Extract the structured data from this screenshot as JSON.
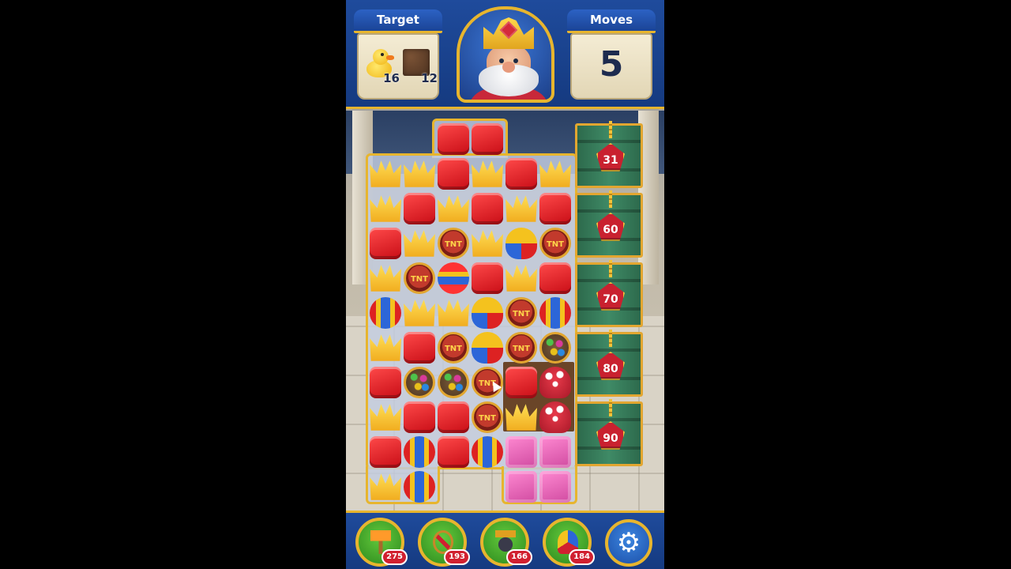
{
  "header": {
    "target_label": "Target",
    "moves_label": "Moves",
    "moves_left": "5",
    "targets": [
      {
        "icon": "rubber-duck-icon",
        "count": "16"
      },
      {
        "icon": "dirt-tile-icon",
        "count": "12"
      }
    ]
  },
  "locked_columns": [
    {
      "count": "31"
    },
    {
      "count": "60"
    },
    {
      "count": "70"
    },
    {
      "count": "80"
    },
    {
      "count": "90"
    }
  ],
  "boosters": [
    {
      "name": "hammer",
      "icon": "hammer-icon",
      "count": "275"
    },
    {
      "name": "arrow",
      "icon": "arrow-icon",
      "count": "193"
    },
    {
      "name": "cannon",
      "icon": "cannon-icon",
      "count": "166"
    },
    {
      "name": "jester-hat",
      "icon": "jester-hat-icon",
      "count": "184"
    }
  ],
  "settings": {
    "icon": "gear-icon"
  },
  "colors": {
    "header_blue": "#1f4b9c",
    "gold_trim": "#e7b52e",
    "red_cube": "#e1212a",
    "crown_yellow": "#f4c21e",
    "lock_green": "#3f8a66",
    "badge_red": "#d12030"
  },
  "board": {
    "rows": [
      [
        "",
        "",
        "red",
        "red",
        "",
        ""
      ],
      [
        "crown",
        "crown",
        "red",
        "crown",
        "red",
        "crown"
      ],
      [
        "crown",
        "red",
        "crown",
        "red",
        "crown",
        "red"
      ],
      [
        "red",
        "crown",
        "tnt",
        "crown",
        "propeller",
        "tnt"
      ],
      [
        "crown",
        "tnt",
        "ball",
        "red",
        "crown",
        "red"
      ],
      [
        "rocket",
        "crown",
        "crown",
        "propeller",
        "tnt",
        "rocket"
      ],
      [
        "crown",
        "red",
        "tnt",
        "propeller",
        "tnt",
        "bomb"
      ],
      [
        "red",
        "bomb",
        "bomb",
        "tnt",
        "red",
        "mushroom"
      ],
      [
        "crown",
        "red",
        "red",
        "tnt",
        "crown",
        "mushroom"
      ],
      [
        "red",
        "rocket",
        "red",
        "rocket",
        "pink",
        "pink"
      ],
      [
        "crown",
        "rocket",
        "",
        "",
        "pink",
        "pink"
      ]
    ]
  }
}
